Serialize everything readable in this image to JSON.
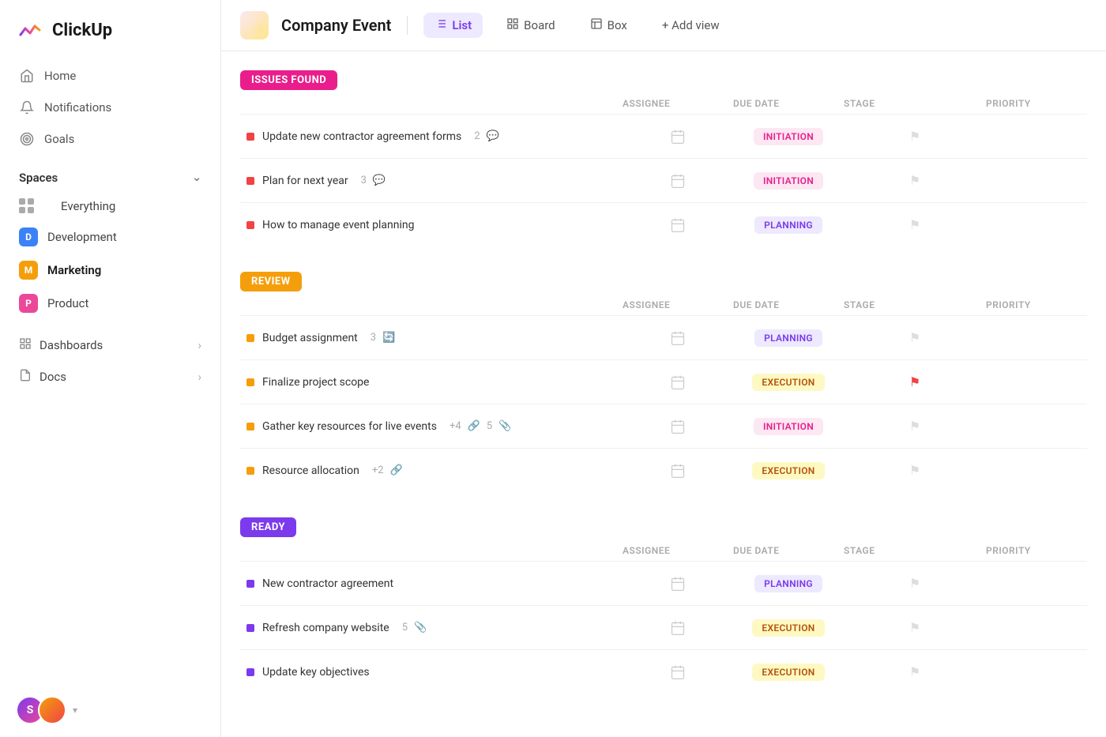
{
  "app": {
    "name": "ClickUp"
  },
  "sidebar": {
    "nav": [
      {
        "id": "home",
        "label": "Home",
        "icon": "🏠"
      },
      {
        "id": "notifications",
        "label": "Notifications",
        "icon": "🔔"
      },
      {
        "id": "goals",
        "label": "Goals",
        "icon": "🎯"
      }
    ],
    "spaces_label": "Spaces",
    "spaces": [
      {
        "id": "everything",
        "label": "Everything",
        "type": "dots"
      },
      {
        "id": "development",
        "label": "Development",
        "color": "#3b82f6",
        "letter": "D"
      },
      {
        "id": "marketing",
        "label": "Marketing",
        "color": "#f59e0b",
        "letter": "M",
        "active": true
      },
      {
        "id": "product",
        "label": "Product",
        "color": "#ec4899",
        "letter": "P"
      }
    ],
    "sections": [
      {
        "id": "dashboards",
        "label": "Dashboards",
        "has_arrow": true
      },
      {
        "id": "docs",
        "label": "Docs",
        "has_arrow": true
      }
    ]
  },
  "topbar": {
    "project_name": "Company Event",
    "tabs": [
      {
        "id": "list",
        "label": "List",
        "icon": "≡",
        "active": true
      },
      {
        "id": "board",
        "label": "Board",
        "icon": "⊞",
        "active": false
      },
      {
        "id": "box",
        "label": "Box",
        "icon": "⊟",
        "active": false
      }
    ],
    "add_view": "+ Add view"
  },
  "columns": {
    "assignee": "ASSIGNEE",
    "due_date": "DUE DATE",
    "stage": "STAGE",
    "priority": "PRIORITY"
  },
  "sections": [
    {
      "id": "issues-found",
      "label": "ISSUES FOUND",
      "badge_class": "badge-issues",
      "tasks": [
        {
          "name": "Update new contractor agreement forms",
          "meta": "2",
          "meta_icon": "💬",
          "dot": "dot-red",
          "stage": "INITIATION",
          "stage_class": "stage-initiation",
          "priority_red": false
        },
        {
          "name": "Plan for next year",
          "meta": "3",
          "meta_icon": "💬",
          "dot": "dot-red",
          "stage": "INITIATION",
          "stage_class": "stage-initiation",
          "priority_red": false
        },
        {
          "name": "How to manage event planning",
          "meta": "",
          "meta_icon": "",
          "dot": "dot-red",
          "stage": "PLANNING",
          "stage_class": "stage-planning",
          "priority_red": false
        }
      ]
    },
    {
      "id": "review",
      "label": "REVIEW",
      "badge_class": "badge-review",
      "tasks": [
        {
          "name": "Budget assignment",
          "meta": "3",
          "meta_icon": "🔄",
          "dot": "dot-yellow",
          "stage": "PLANNING",
          "stage_class": "stage-planning",
          "priority_red": false
        },
        {
          "name": "Finalize project scope",
          "meta": "",
          "meta_icon": "",
          "dot": "dot-yellow",
          "stage": "EXECUTION",
          "stage_class": "stage-execution",
          "priority_red": true
        },
        {
          "name": "Gather key resources for live events",
          "meta": "+4  5",
          "meta_icon": "📎",
          "dot": "dot-yellow",
          "stage": "INITIATION",
          "stage_class": "stage-initiation",
          "priority_red": false
        },
        {
          "name": "Resource allocation",
          "meta": "+2",
          "meta_icon": "🔗",
          "dot": "dot-yellow",
          "stage": "EXECUTION",
          "stage_class": "stage-execution",
          "priority_red": false
        }
      ]
    },
    {
      "id": "ready",
      "label": "READY",
      "badge_class": "badge-ready",
      "tasks": [
        {
          "name": "New contractor agreement",
          "meta": "",
          "meta_icon": "",
          "dot": "dot-purple",
          "stage": "PLANNING",
          "stage_class": "stage-planning",
          "priority_red": false
        },
        {
          "name": "Refresh company website",
          "meta": "5",
          "meta_icon": "📎",
          "dot": "dot-purple",
          "stage": "EXECUTION",
          "stage_class": "stage-execution",
          "priority_red": false
        },
        {
          "name": "Update key objectives",
          "meta": "",
          "meta_icon": "",
          "dot": "dot-purple",
          "stage": "EXECUTION",
          "stage_class": "stage-execution",
          "priority_red": false
        }
      ]
    }
  ],
  "avatars": {
    "colors": [
      "#7c3aed",
      "#ef4444",
      "#f59e0b",
      "#10b981",
      "#3b82f6",
      "#ec4899"
    ]
  }
}
